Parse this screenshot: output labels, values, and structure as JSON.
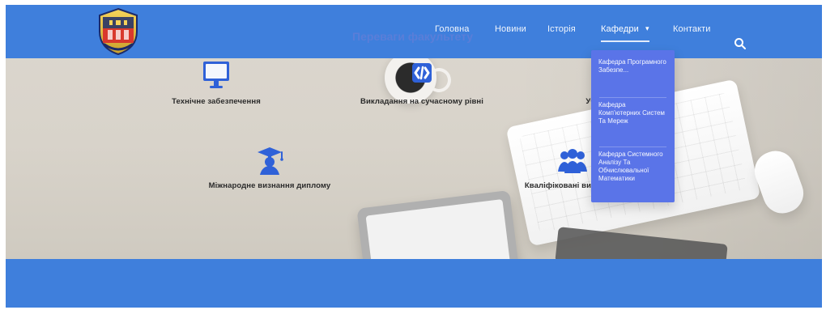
{
  "colors": {
    "primary": "#3f7fdc",
    "dropdown_bg": "#5a74e8",
    "icon_blue": "#2f61d8",
    "section_title": "#5f7ed8",
    "text_dark": "#2b2b2b"
  },
  "header": {
    "logo_name": "university-crest",
    "nav": [
      {
        "label": "Головна"
      },
      {
        "label": "Новини"
      },
      {
        "label": "Історія"
      },
      {
        "label": "Кафедри",
        "caret": "▾",
        "active": true
      },
      {
        "label": "Контакти"
      }
    ],
    "search_icon": "search-icon"
  },
  "section": {
    "title": "Переваги факультету"
  },
  "features": [
    {
      "icon": "monitor-icon",
      "label": "Технічне забезпечення"
    },
    {
      "icon": "code-icon",
      "label": "Викладання на сучасному рівні"
    },
    {
      "icon": "briefcase-icon",
      "label": "Участь у проектах"
    },
    {
      "icon": "graduate-icon",
      "label": "Міжнародне визнання диплому"
    },
    {
      "icon": "team-icon",
      "label": "Кваліфіковані викладачі"
    }
  ],
  "dropdown": {
    "items": [
      {
        "label": "Кафедра Програмного Забезпе..."
      },
      {
        "label": "Кафедра Комп’ютерних Систем Та Мереж"
      },
      {
        "label": "Кафедра Системного Аналізу Та Обчислювальної Математики"
      }
    ]
  }
}
